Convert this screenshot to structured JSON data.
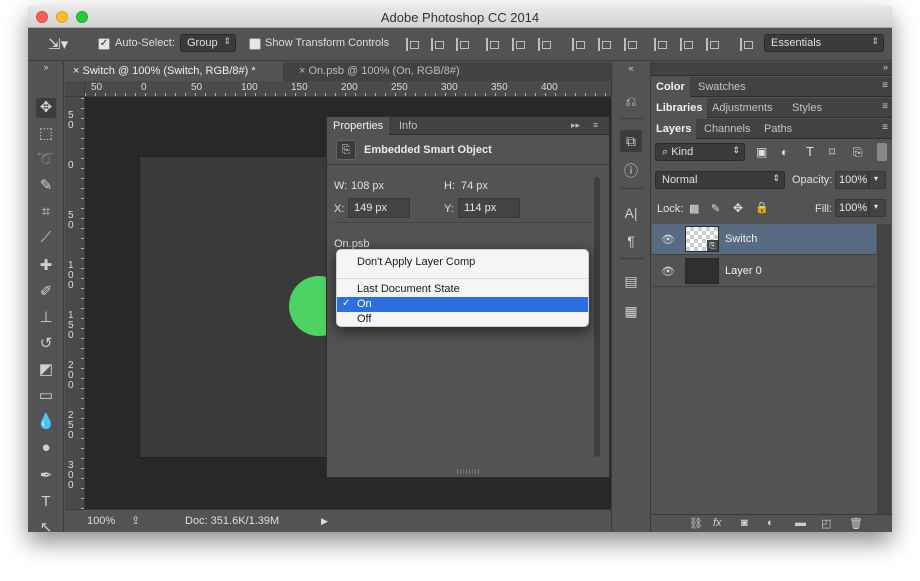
{
  "app": {
    "title": "Adobe Photoshop CC 2014"
  },
  "options_bar": {
    "auto_select_label": "Auto-Select:",
    "auto_select_value": "Group",
    "show_transform_label": "Show Transform Controls",
    "workspace": "Essentials"
  },
  "doc_tabs": [
    {
      "label": "Switch @ 100% (Switch, RGB/8#) *"
    },
    {
      "label": "On.psb @ 100% (On, RGB/8#)"
    }
  ],
  "ruler": {
    "h_ticks": [
      "50",
      "0",
      "50",
      "100",
      "150",
      "200",
      "250",
      "300",
      "350",
      "400"
    ],
    "v_ticks": [
      "50",
      "0",
      "50",
      "100",
      "150",
      "200",
      "250",
      "300",
      "350"
    ]
  },
  "status": {
    "zoom": "100%",
    "doc": "Doc: 351.6K/1.39M"
  },
  "properties": {
    "tabs": [
      "Properties",
      "Info"
    ],
    "title": "Embedded Smart Object",
    "w_label": "W:",
    "w_value": "108 px",
    "h_label": "H:",
    "h_value": "74 px",
    "x_label": "X:",
    "x_value": "149 px",
    "y_label": "Y:",
    "y_value": "114 px",
    "file_name": "On.psb"
  },
  "layer_comp_menu": {
    "items": [
      "Don't Apply Layer Comp",
      "Last Document State",
      "On",
      "Off"
    ],
    "selected": "On",
    "check": "✓"
  },
  "right_panels": {
    "row1_tabs": [
      "Color",
      "Swatches"
    ],
    "row2_tabs": [
      "Libraries",
      "Adjustments",
      "Styles"
    ],
    "row3_tabs": [
      "Layers",
      "Channels",
      "Paths"
    ],
    "filter_kind": "Kind",
    "blend_mode": "Normal",
    "opacity_label": "Opacity:",
    "opacity_value": "100%",
    "lock_label": "Lock:",
    "fill_label": "Fill:",
    "fill_value": "100%",
    "layers": [
      {
        "name": "Switch",
        "selected": true
      },
      {
        "name": "Layer 0",
        "selected": false
      }
    ]
  },
  "colors": {
    "accent": "#2d6ee1",
    "green": "#4cd364",
    "layer_selected": "#596b82"
  }
}
